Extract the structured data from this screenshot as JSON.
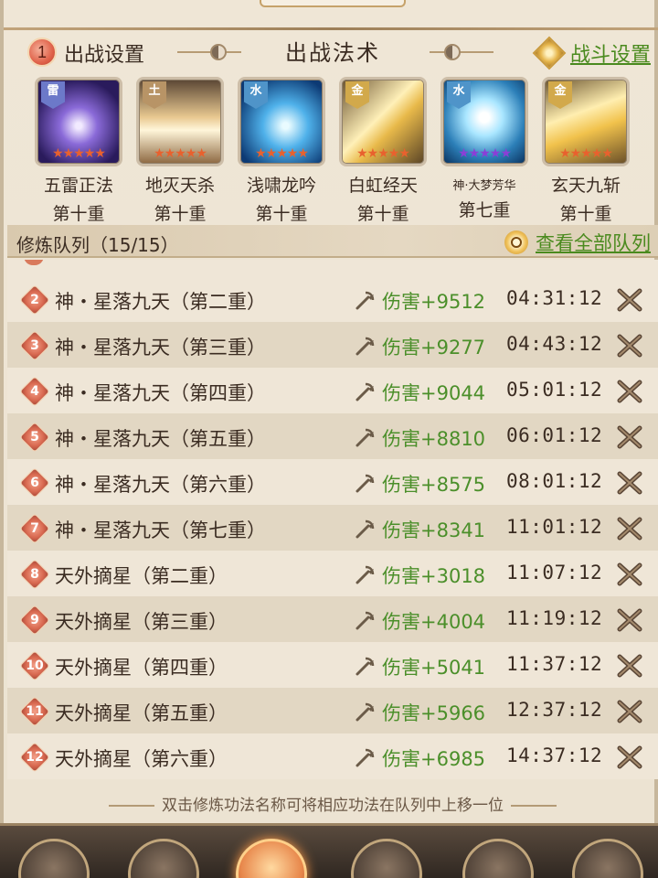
{
  "header": {
    "badge": "1",
    "settings_title": "出战设置",
    "center_title": "出战法术",
    "battle_settings": "战斗设置"
  },
  "spells": [
    {
      "element": "雷",
      "name": "五雷正法",
      "rank": "第十重",
      "stars": "★★★★★",
      "star_color": "#e8612e",
      "tag_color": "#6c79c9"
    },
    {
      "element": "土",
      "name": "地灭天杀",
      "rank": "第十重",
      "stars": "★★★★★",
      "star_color": "#e8612e",
      "tag_color": "#b89466"
    },
    {
      "element": "水",
      "name": "浅啸龙吟",
      "rank": "第十重",
      "stars": "★★★★★",
      "star_color": "#e8612e",
      "tag_color": "#4f94c9"
    },
    {
      "element": "金",
      "name": "白虹经天",
      "rank": "第十重",
      "stars": "★★★★★",
      "star_color": "#e8612e",
      "tag_color": "#d2a94b"
    },
    {
      "element": "水",
      "name": "神·大梦芳华",
      "rank": "第七重",
      "stars": "★★★★★",
      "star_color": "#8a3fd6",
      "tag_color": "#4f94c9"
    },
    {
      "element": "金",
      "name": "玄天九斩",
      "rank": "第十重",
      "stars": "★★★★★",
      "star_color": "#e8612e",
      "tag_color": "#d2a94b"
    }
  ],
  "queue": {
    "title": "修炼队列（15/15）",
    "view_all": "查看全部队列",
    "rows": [
      {
        "num": "2",
        "name": "神・星落九天（第二重）",
        "damage": "伤害+9512",
        "time": "04:31:12"
      },
      {
        "num": "3",
        "name": "神・星落九天（第三重）",
        "damage": "伤害+9277",
        "time": "04:43:12"
      },
      {
        "num": "4",
        "name": "神・星落九天（第四重）",
        "damage": "伤害+9044",
        "time": "05:01:12"
      },
      {
        "num": "5",
        "name": "神・星落九天（第五重）",
        "damage": "伤害+8810",
        "time": "06:01:12"
      },
      {
        "num": "6",
        "name": "神・星落九天（第六重）",
        "damage": "伤害+8575",
        "time": "08:01:12"
      },
      {
        "num": "7",
        "name": "神・星落九天（第七重）",
        "damage": "伤害+8341",
        "time": "11:01:12"
      },
      {
        "num": "8",
        "name": "天外摘星（第二重）",
        "damage": "伤害+3018",
        "time": "11:07:12"
      },
      {
        "num": "9",
        "name": "天外摘星（第三重）",
        "damage": "伤害+4004",
        "time": "11:19:12"
      },
      {
        "num": "10",
        "name": "天外摘星（第四重）",
        "damage": "伤害+5041",
        "time": "11:37:12"
      },
      {
        "num": "11",
        "name": "天外摘星（第五重）",
        "damage": "伤害+5966",
        "time": "12:37:12"
      },
      {
        "num": "12",
        "name": "天外摘星（第六重）",
        "damage": "伤害+6985",
        "time": "14:37:12"
      }
    ]
  },
  "hint": "双击修炼功法名称可将相应功法在队列中上移一位"
}
